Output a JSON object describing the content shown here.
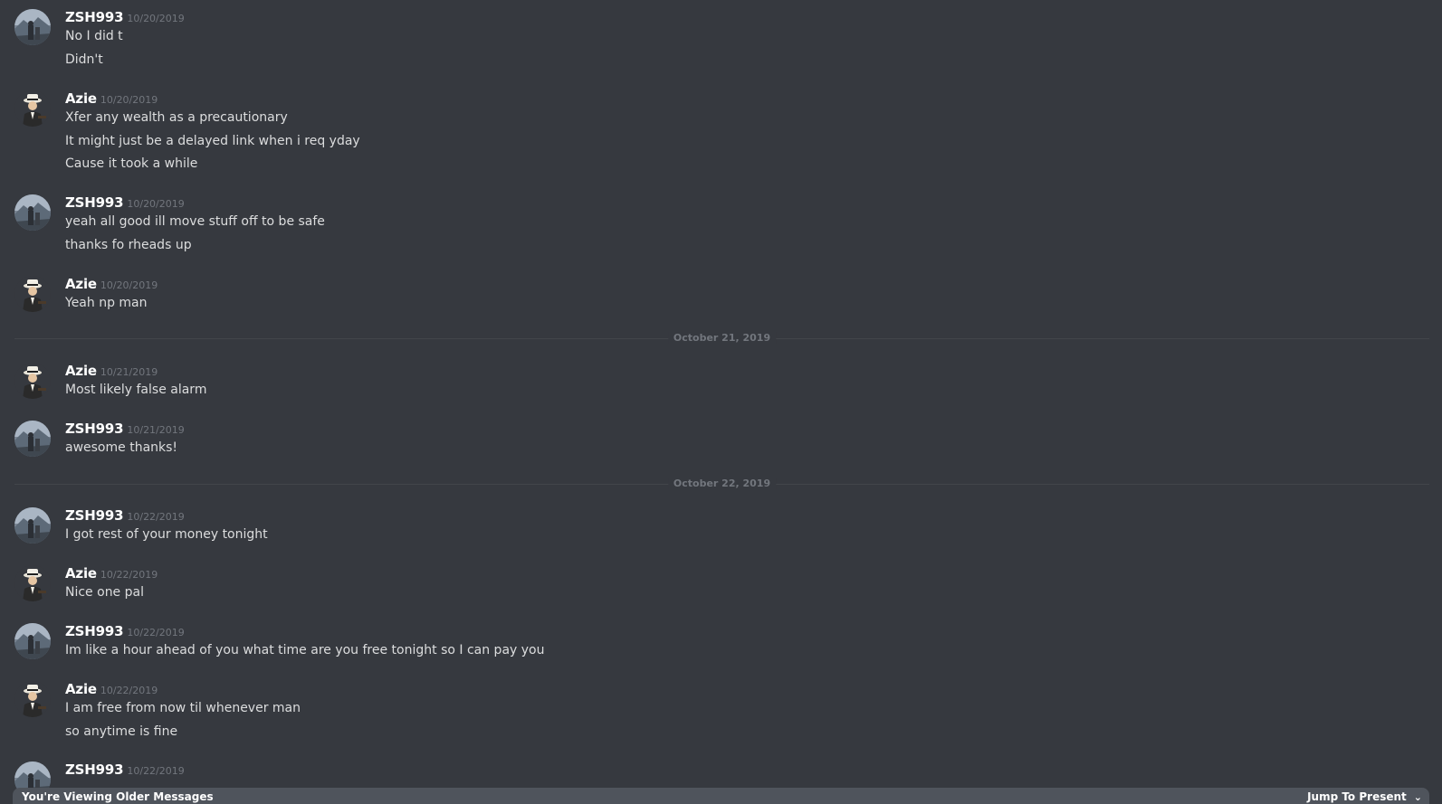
{
  "colors": {
    "background": "#36393f",
    "username": "#ffffff",
    "message_text": "#dcddde",
    "timestamp": "#72767d",
    "divider": "#42454a",
    "banner": "#4f545c"
  },
  "messages": [
    {
      "author": "ZSH993",
      "avatar": "mountain-scene-avatar",
      "time": "10/20/2019",
      "lines": [
        "No I did t",
        "Didn't"
      ]
    },
    {
      "author": "Azie",
      "avatar": "gangster-fedora-avatar",
      "time": "10/20/2019",
      "lines": [
        "Xfer any wealth as a precautionary",
        "It might just be a delayed link when i req yday",
        "Cause it took a while"
      ]
    },
    {
      "author": "ZSH993",
      "avatar": "mountain-scene-avatar",
      "time": "10/20/2019",
      "lines": [
        "yeah all good ill move stuff off to be safe",
        "thanks fo rheads up"
      ]
    },
    {
      "author": "Azie",
      "avatar": "gangster-fedora-avatar",
      "time": "10/20/2019",
      "lines": [
        "Yeah np man"
      ]
    },
    {
      "divider": "October 21, 2019"
    },
    {
      "author": "Azie",
      "avatar": "gangster-fedora-avatar",
      "time": "10/21/2019",
      "lines": [
        "Most likely false alarm"
      ]
    },
    {
      "author": "ZSH993",
      "avatar": "mountain-scene-avatar",
      "time": "10/21/2019",
      "lines": [
        "awesome thanks!"
      ]
    },
    {
      "divider": "October 22, 2019"
    },
    {
      "author": "ZSH993",
      "avatar": "mountain-scene-avatar",
      "time": "10/22/2019",
      "lines": [
        "I got rest of your money tonight"
      ]
    },
    {
      "author": "Azie",
      "avatar": "gangster-fedora-avatar",
      "time": "10/22/2019",
      "lines": [
        "Nice one pal"
      ]
    },
    {
      "author": "ZSH993",
      "avatar": "mountain-scene-avatar",
      "time": "10/22/2019",
      "lines": [
        "Im like a hour ahead of you what time are you free tonight so I can pay you"
      ]
    },
    {
      "author": "Azie",
      "avatar": "gangster-fedora-avatar",
      "time": "10/22/2019",
      "lines": [
        "I am free from now til whenever man",
        "so anytime is fine"
      ]
    },
    {
      "author": "ZSH993",
      "avatar": "mountain-scene-avatar",
      "time": "10/22/2019",
      "lines": []
    }
  ],
  "banner": {
    "text": "You're Viewing Older Messages",
    "jump_label": "Jump To Present",
    "jump_icon": "chevron-down-icon"
  }
}
